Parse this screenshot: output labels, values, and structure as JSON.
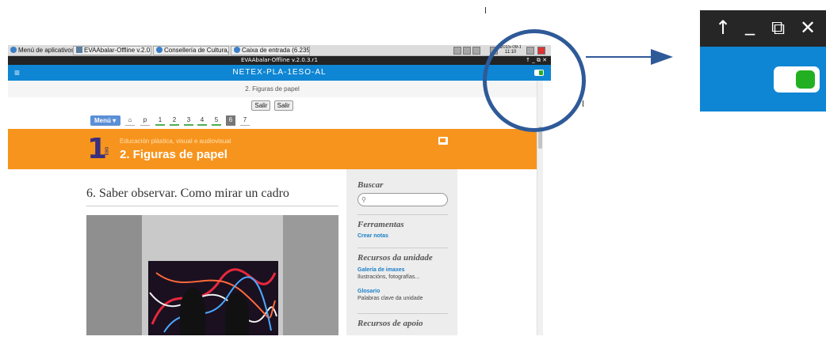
{
  "taskbar": {
    "menu": "Menú de aplicativos",
    "tasks": [
      "EVAAbalar-Offline v.2.0....",
      "Consellería de Cultura, ...",
      "Caixa de entrada (6.235..."
    ],
    "clock_date": "2015-09-14",
    "clock_time": "11:10"
  },
  "window": {
    "title": "EVAAbalar-Offline v.2.0.3.r1",
    "controls": "↑ _ ⧉ ✕"
  },
  "appbar": {
    "menu_glyph": "≡",
    "title": "NETEX-PLA-1ESO-AL"
  },
  "page": {
    "subhead": "2. Figuras de papel",
    "buttons": [
      "Salir",
      "Salir"
    ],
    "menu_label": "Menú ▾",
    "home_glyph": "⌂",
    "pages": [
      "p",
      "1",
      "2",
      "3",
      "4",
      "5",
      "6",
      "7"
    ],
    "active_page": "6"
  },
  "banner": {
    "grade": "1",
    "grade_sub": "ESO",
    "subject": "Educación plástica, visual e audiovisual",
    "title": "2. Figuras de papel"
  },
  "article": {
    "title": "6. Saber observar. Como mirar un cadro"
  },
  "sidebar": {
    "search_heading": "Buscar",
    "search_placeholder": "",
    "tools_heading": "Ferramentas",
    "tools_link": "Crear notas",
    "unit_heading": "Recursos da unidade",
    "gallery_link": "Galería de imaxes",
    "gallery_desc": "Ilustracións, fotografías...",
    "glossary_link": "Glosario",
    "glossary_desc": "Palabras clave da unidade",
    "support_heading": "Recursos de apoio"
  },
  "zoom": {
    "controls": [
      "↑",
      "_",
      "⧉",
      "✕"
    ]
  },
  "colors": {
    "app_blue": "#0e86d4",
    "orange": "#f7941d",
    "toggle_green": "#22b022",
    "callout": "#2f5a98"
  }
}
